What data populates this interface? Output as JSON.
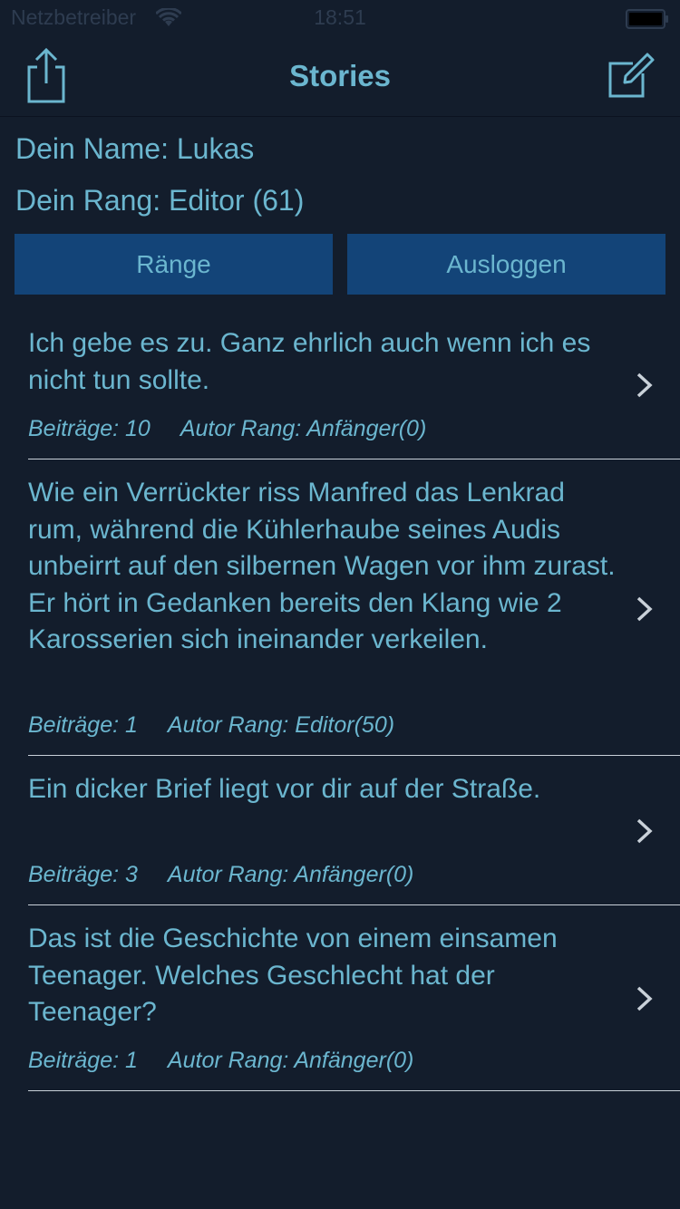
{
  "status_bar": {
    "carrier": "Netzbetreiber",
    "time": "18:51"
  },
  "nav": {
    "title": "Stories",
    "left_icon": "share-icon",
    "right_icon": "compose-icon"
  },
  "profile": {
    "name_line": "Dein Name: Lukas",
    "rank_line": "Dein Rang: Editor (61)"
  },
  "buttons": {
    "ranks_label": "Ränge",
    "logout_label": "Ausloggen"
  },
  "stories": [
    {
      "text": "Ich gebe es zu. Ganz ehrlich auch wenn ich es nicht tun sollte.",
      "posts": "Beiträge: 10",
      "author_rank": "Autor Rang: Anfänger(0)"
    },
    {
      "text": "Wie ein Verrückter riss Manfred das Lenkrad rum, während die Kühlerhaube seines Audis unbeirrt auf den silbernen Wagen vor ihm zurast. Er hört in Gedanken bereits den Klang wie 2 Karosserien sich ineinander verkeilen.",
      "posts": "Beiträge: 1",
      "author_rank": "Autor Rang: Editor(50)"
    },
    {
      "text": "Ein dicker Brief liegt vor dir auf der Straße.",
      "posts": "Beiträge: 3",
      "author_rank": "Autor Rang: Anfänger(0)"
    },
    {
      "text": "Das ist die Geschichte von einem einsamen Teenager. Welches Geschlecht hat der Teenager?",
      "posts": "Beiträge: 1",
      "author_rank": "Autor Rang: Anfänger(0)"
    }
  ],
  "colors": {
    "background": "#131d2c",
    "accent": "#6bb6cf",
    "button": "#134478",
    "status_text": "#2e3c50",
    "separator": "#c9d1d9"
  }
}
